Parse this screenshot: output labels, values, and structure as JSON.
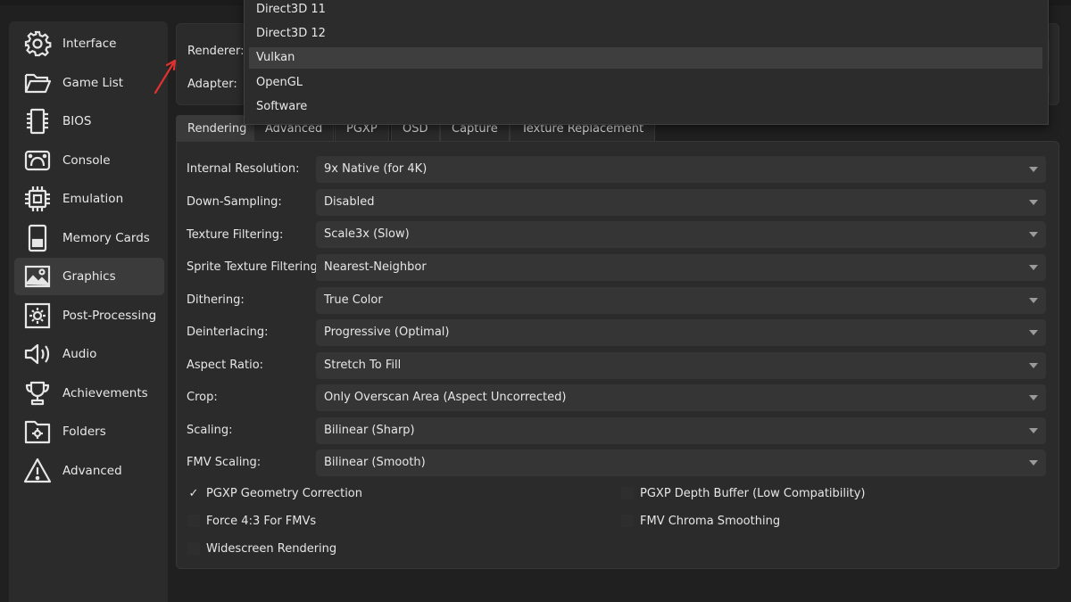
{
  "sidebar": {
    "items": [
      {
        "label": "Interface",
        "icon": "gear-icon"
      },
      {
        "label": "Game List",
        "icon": "folder-open-icon"
      },
      {
        "label": "BIOS",
        "icon": "chip-icon"
      },
      {
        "label": "Console",
        "icon": "console-icon"
      },
      {
        "label": "Emulation",
        "icon": "cpu-icon"
      },
      {
        "label": "Memory Cards",
        "icon": "memory-card-icon"
      },
      {
        "label": "Graphics",
        "icon": "image-icon",
        "active": true
      },
      {
        "label": "Post-Processing",
        "icon": "brightness-icon"
      },
      {
        "label": "Audio",
        "icon": "speaker-icon"
      },
      {
        "label": "Achievements",
        "icon": "trophy-icon"
      },
      {
        "label": "Folders",
        "icon": "folder-gear-icon"
      },
      {
        "label": "Advanced",
        "icon": "warning-icon"
      }
    ]
  },
  "top": {
    "renderer_label": "Renderer:",
    "adapter_label": "Adapter:"
  },
  "renderer_dropdown": {
    "options": [
      "Direct3D 11",
      "Direct3D 12",
      "Vulkan",
      "OpenGL",
      "Software"
    ],
    "selected": "Vulkan"
  },
  "tabs": [
    "Rendering",
    "Advanced",
    "PGXP",
    "OSD",
    "Capture",
    "Texture Replacement"
  ],
  "settings": [
    {
      "label": "Internal Resolution:",
      "value": "9x Native (for 4K)"
    },
    {
      "label": "Down-Sampling:",
      "value": "Disabled"
    },
    {
      "label": "Texture Filtering:",
      "value": "Scale3x (Slow)"
    },
    {
      "label": "Sprite Texture Filtering:",
      "value": "Nearest-Neighbor"
    },
    {
      "label": "Dithering:",
      "value": "True Color"
    },
    {
      "label": "Deinterlacing:",
      "value": "Progressive (Optimal)"
    },
    {
      "label": "Aspect Ratio:",
      "value": "Stretch To Fill"
    },
    {
      "label": "Crop:",
      "value": "Only Overscan Area (Aspect Uncorrected)"
    },
    {
      "label": "Scaling:",
      "value": "Bilinear (Sharp)"
    },
    {
      "label": "FMV Scaling:",
      "value": "Bilinear (Smooth)"
    }
  ],
  "checkboxes": [
    {
      "label": "PGXP Geometry Correction",
      "checked": true
    },
    {
      "label": "PGXP Depth Buffer (Low Compatibility)",
      "checked": false
    },
    {
      "label": "Force 4:3 For FMVs",
      "checked": false
    },
    {
      "label": "FMV Chroma Smoothing",
      "checked": false
    },
    {
      "label": "Widescreen Rendering",
      "checked": false
    }
  ],
  "colors": {
    "background": "#202020",
    "panel": "#2b2b2b",
    "select": "#353535",
    "annotation_arrow": "#e03030"
  }
}
